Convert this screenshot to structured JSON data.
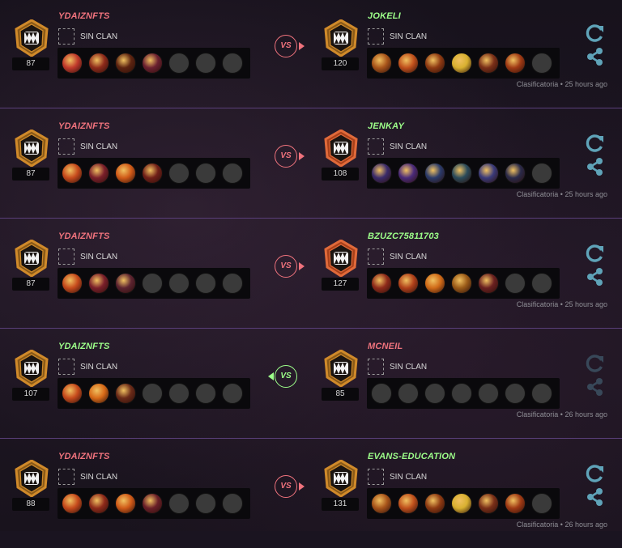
{
  "battles": [
    {
      "player": {
        "name": "YDAIZNFTS",
        "rating": "87",
        "clan": "SIN CLAN",
        "result": "lose",
        "cards": [
          "#c0392b",
          "#8e2a1a",
          "#5c2310",
          "#6b2030",
          "",
          "",
          ""
        ]
      },
      "opponent": {
        "name": "JOKELI",
        "rating": "120",
        "clan": "SIN CLAN",
        "result": "win",
        "cards": [
          "#a8541a",
          "#c0501c",
          "#8e3a12",
          "#d8b030",
          "#7a2f18",
          "#a03a14",
          ""
        ]
      },
      "vs_label": "VS",
      "vs_winner": "right",
      "match_type": "Clasificatoria",
      "separator": "•",
      "time_ago": "25 hours ago"
    },
    {
      "player": {
        "name": "YDAIZNFTS",
        "rating": "87",
        "clan": "SIN CLAN",
        "result": "lose",
        "cards": [
          "#c64a1c",
          "#7a1f2a",
          "#d05a18",
          "#701f18",
          "",
          "",
          ""
        ]
      },
      "opponent": {
        "name": "JENKAY",
        "rating": "108",
        "clan": "SIN CLAN",
        "result": "win",
        "cards": [
          "#3a2a6a",
          "#4a2a7a",
          "#2a3a6a",
          "#2a4a5a",
          "#3a3a7a",
          "#2a2a4a",
          ""
        ]
      },
      "vs_label": "VS",
      "vs_winner": "right",
      "match_type": "Clasificatoria",
      "separator": "•",
      "time_ago": "25 hours ago"
    },
    {
      "player": {
        "name": "YDAIZNFTS",
        "rating": "87",
        "clan": "SIN CLAN",
        "result": "lose",
        "cards": [
          "#c64a1c",
          "#7a1f2a",
          "#5c2330",
          "",
          "",
          "",
          ""
        ]
      },
      "opponent": {
        "name": "BZUZC75811703",
        "rating": "127",
        "clan": "SIN CLAN",
        "result": "win",
        "cards": [
          "#8e2a1a",
          "#b0401a",
          "#d06a18",
          "#9a5a18",
          "#6a2020",
          "",
          ""
        ]
      },
      "vs_label": "VS",
      "vs_winner": "right",
      "match_type": "Clasificatoria",
      "separator": "•",
      "time_ago": "25 hours ago"
    },
    {
      "player": {
        "name": "YDAIZNFTS",
        "rating": "107",
        "clan": "SIN CLAN",
        "result": "win",
        "cards": [
          "#c64a1c",
          "#d86a18",
          "#6a2a18",
          "",
          "",
          "",
          ""
        ]
      },
      "opponent": {
        "name": "MCNEIL",
        "rating": "85",
        "clan": "SIN CLAN",
        "result": "lose",
        "cards": [
          "",
          "",
          "",
          "",
          "",
          "",
          ""
        ]
      },
      "vs_label": "VS",
      "vs_winner": "left",
      "match_type": "Clasificatoria",
      "separator": "•",
      "time_ago": "26 hours ago"
    },
    {
      "player": {
        "name": "YDAIZNFTS",
        "rating": "88",
        "clan": "SIN CLAN",
        "result": "lose",
        "cards": [
          "#c64a1c",
          "#8e2a1a",
          "#d05a18",
          "#6a1f28",
          "",
          "",
          ""
        ]
      },
      "opponent": {
        "name": "EVANS-EDUCATION",
        "rating": "131",
        "clan": "SIN CLAN",
        "result": "win",
        "cards": [
          "#a8541a",
          "#c0501c",
          "#8e3a12",
          "#d8b030",
          "#7a2f18",
          "#a03a14",
          ""
        ]
      },
      "vs_label": "VS",
      "vs_winner": "right",
      "match_type": "Clasificatoria",
      "separator": "•",
      "time_ago": "26 hours ago"
    }
  ],
  "icons": {
    "replay": "replay-icon",
    "share": "share-icon",
    "badge": "league-badge-icon"
  },
  "colors": {
    "win": "#9dff8a",
    "lose": "#f0737d",
    "accent": "#5fa3b8",
    "divider": "#5a3f7a"
  }
}
